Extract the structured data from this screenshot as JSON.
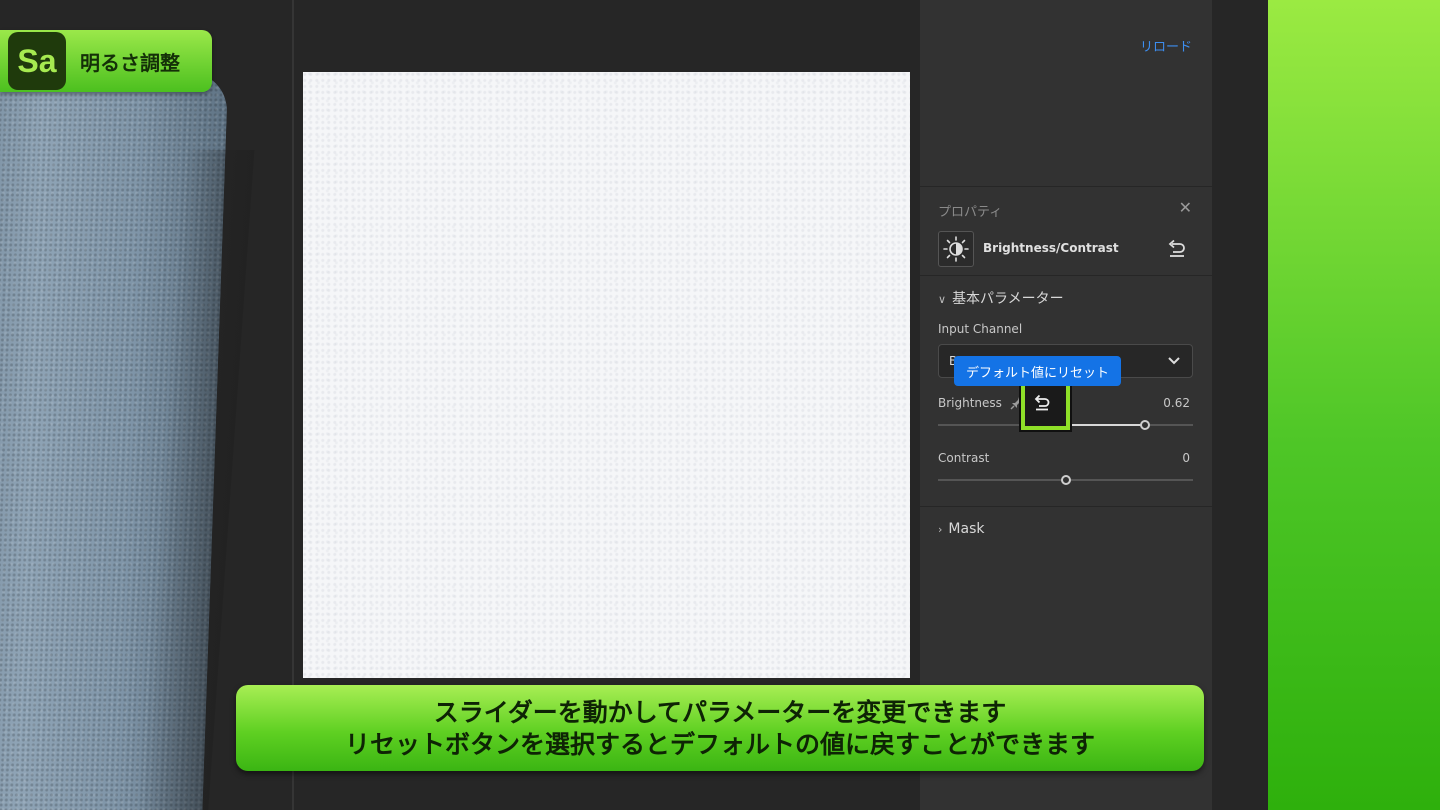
{
  "badge": {
    "logo": "Sa",
    "title": "明るさ調整"
  },
  "panel": {
    "reload_label": "リロード",
    "properties_label": "プロパティ",
    "close_icon": "close-icon",
    "adjustment_name": "Brightness/Contrast",
    "section_basic": "基本パラメーター",
    "input_channel_label": "Input Channel",
    "input_channel_value": "B",
    "tooltip": "デフォルト値にリセット",
    "brightness": {
      "label": "Brightness",
      "value": "0.62",
      "level": 0.62
    },
    "contrast": {
      "label": "Contrast",
      "value": "0",
      "level": 0.0
    },
    "section_mask": "Mask"
  },
  "subtitle": {
    "line1": "スライダーを動かしてパラメーターを変更できます",
    "line2": "リセットボタンを選択するとデフォルトの値に戻すことができます"
  },
  "colors": {
    "accent_blue": "#1473e6",
    "highlight_green": "#8fe028",
    "badge_green": "#5fd022"
  }
}
